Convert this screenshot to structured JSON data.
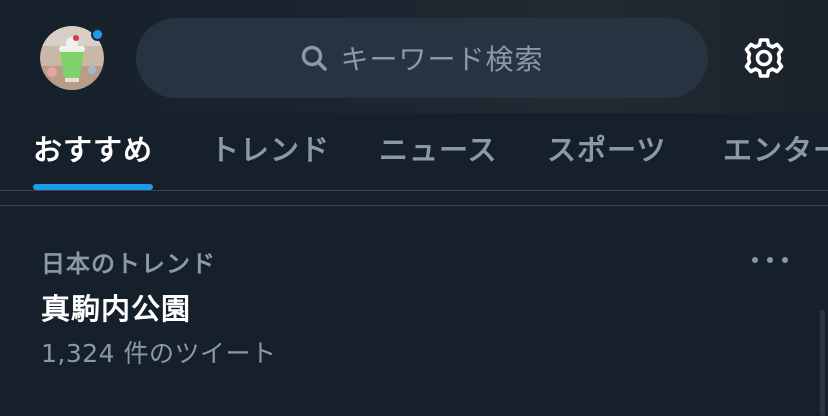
{
  "header": {
    "search_placeholder": "キーワード検索",
    "notification_dot_color": "#1d9bf0",
    "icons": [
      "search-icon",
      "gear-icon"
    ]
  },
  "tabs": [
    {
      "label": "おすすめ",
      "active": true
    },
    {
      "label": "トレンド",
      "active": false
    },
    {
      "label": "ニュース",
      "active": false
    },
    {
      "label": "スポーツ",
      "active": false
    },
    {
      "label": "エンター",
      "active": false
    }
  ],
  "trend": {
    "context": "日本のトレンド",
    "title": "真駒内公園",
    "count": "1,324 件のツイート"
  },
  "colors": {
    "background": "#15202b",
    "accent": "#1d9bf0",
    "secondary_text": "#8b98a5",
    "search_bg": "#273340"
  }
}
